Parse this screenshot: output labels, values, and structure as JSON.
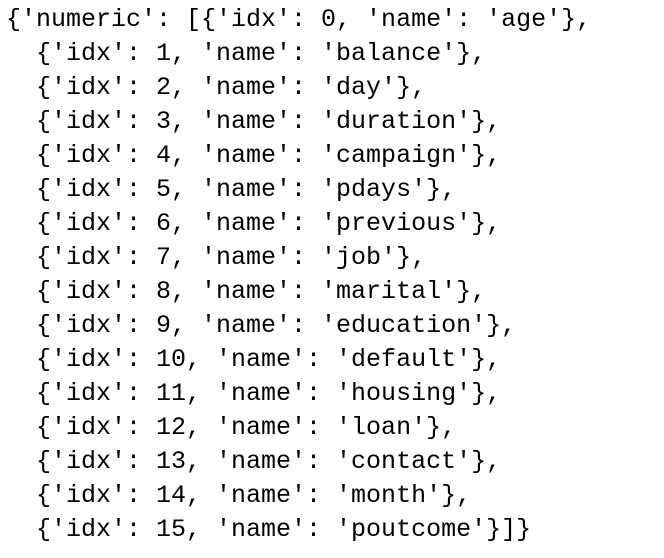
{
  "output": {
    "lines": [
      "{'numeric': [{'idx': 0, 'name': 'age'},",
      "  {'idx': 1, 'name': 'balance'},",
      "  {'idx': 2, 'name': 'day'},",
      "  {'idx': 3, 'name': 'duration'},",
      "  {'idx': 4, 'name': 'campaign'},",
      "  {'idx': 5, 'name': 'pdays'},",
      "  {'idx': 6, 'name': 'previous'},",
      "  {'idx': 7, 'name': 'job'},",
      "  {'idx': 8, 'name': 'marital'},",
      "  {'idx': 9, 'name': 'education'},",
      "  {'idx': 10, 'name': 'default'},",
      "  {'idx': 11, 'name': 'housing'},",
      "  {'idx': 12, 'name': 'loan'},",
      "  {'idx': 13, 'name': 'contact'},",
      "  {'idx': 14, 'name': 'month'},",
      "  {'idx': 15, 'name': 'poutcome'}]}"
    ]
  }
}
